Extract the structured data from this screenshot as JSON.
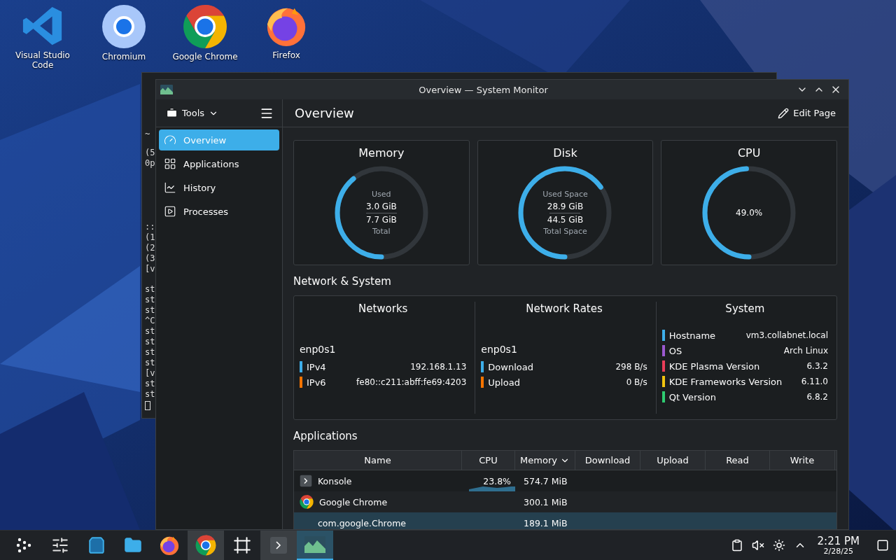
{
  "desktop_icons": [
    {
      "label": "Visual Studio Code",
      "kind": "vscode"
    },
    {
      "label": "Chromium",
      "kind": "chromium"
    },
    {
      "label": "Google Chrome",
      "kind": "chrome"
    },
    {
      "label": "Firefox",
      "kind": "firefox"
    }
  ],
  "terminal": {
    "line_groups": [
      [
        "~"
      ],
      [
        "(5",
        "0p"
      ],
      [
        "::",
        "(1",
        "(2",
        "(3",
        "[v"
      ],
      [
        "st",
        "st",
        "st",
        "^C",
        "st",
        "st",
        "st",
        "st",
        "[v",
        "st",
        "st"
      ]
    ]
  },
  "window": {
    "title": "Overview — System Monitor"
  },
  "toolbar": {
    "tools_label": "Tools",
    "page_title": "Overview",
    "edit_button": "Edit Page"
  },
  "sidebar": {
    "items": [
      {
        "label": "Overview",
        "kind": "gauge",
        "selected": true
      },
      {
        "label": "Applications",
        "kind": "grid",
        "selected": false
      },
      {
        "label": "History",
        "kind": "chart",
        "selected": false
      },
      {
        "label": "Processes",
        "kind": "play",
        "selected": false
      }
    ]
  },
  "summary_cards": [
    {
      "title": "Memory",
      "kind": "split",
      "level": 0.39,
      "top_label": "Used",
      "value_1": "3.0 GiB",
      "value_2": "7.7 GiB",
      "bottom_label": "Total"
    },
    {
      "title": "Disk",
      "kind": "split",
      "level": 0.65,
      "top_label": "Used Space",
      "value_1": "28.9 GiB",
      "value_2": "44.5 GiB",
      "bottom_label": "Total Space"
    },
    {
      "title": "CPU",
      "kind": "single",
      "level": 0.49,
      "value_1": "49.0%"
    }
  ],
  "network_section": {
    "heading": "Network & System",
    "columns": [
      {
        "title": "Networks",
        "kind": "network",
        "interface": "enp0s1",
        "rows": [
          {
            "label": "IPv4",
            "value": "192.168.1.13",
            "color": "#3daee9"
          },
          {
            "label": "IPv6",
            "value": "fe80::c211:abff:fe69:4203",
            "color": "#f67400"
          }
        ]
      },
      {
        "title": "Network Rates",
        "kind": "network",
        "interface": "enp0s1",
        "rows": [
          {
            "label": "Download",
            "value": "298 B/s",
            "color": "#3daee9"
          },
          {
            "label": "Upload",
            "value": "0 B/s",
            "color": "#f67400"
          }
        ]
      },
      {
        "title": "System",
        "kind": "system",
        "rows": [
          {
            "label": "Hostname",
            "value": "vm3.collabnet.local",
            "color": "#3daee9"
          },
          {
            "label": "OS",
            "value": "Arch Linux",
            "color": "#9b59d0"
          },
          {
            "label": "KDE Plasma Version",
            "value": "6.3.2",
            "color": "#e93d58"
          },
          {
            "label": "KDE Frameworks Version",
            "value": "6.11.0",
            "color": "#f1c40f"
          },
          {
            "label": "Qt Version",
            "value": "6.8.2",
            "color": "#2ecc71"
          }
        ]
      }
    ]
  },
  "applications": {
    "heading": "Applications",
    "columns": [
      {
        "label": "Name",
        "sorted": false
      },
      {
        "label": "CPU",
        "sorted": false
      },
      {
        "label": "Memory",
        "sorted": true
      },
      {
        "label": "Download",
        "sorted": false
      },
      {
        "label": "Upload",
        "sorted": false
      },
      {
        "label": "Read",
        "sorted": false
      },
      {
        "label": "Write",
        "sorted": false
      }
    ],
    "rows": [
      {
        "name": "Konsole",
        "kind": "konsole",
        "cpu": "23.8%",
        "memory": "574.7 MiB",
        "selected": false
      },
      {
        "name": "Google Chrome",
        "kind": "chrome",
        "memory": "300.1 MiB",
        "selected": false
      },
      {
        "name": "com.google.Chrome",
        "kind": "child",
        "memory": "189.1 MiB",
        "selected": true
      }
    ]
  },
  "taskbar": {
    "items": [
      {
        "kind": "launcher",
        "open": false,
        "selected": false
      },
      {
        "kind": "settings",
        "open": false,
        "selected": false
      },
      {
        "kind": "store",
        "open": false,
        "selected": false
      },
      {
        "kind": "files",
        "open": false,
        "selected": false
      },
      {
        "kind": "firefox",
        "open": false,
        "selected": false
      },
      {
        "kind": "chrome",
        "open": true,
        "selected": false
      },
      {
        "kind": "frame",
        "open": false,
        "selected": false
      },
      {
        "kind": "konsole",
        "open": true,
        "selected": false
      },
      {
        "kind": "monitor",
        "open": true,
        "selected": true
      }
    ],
    "tray": [
      {
        "kind": "clipboard"
      },
      {
        "kind": "muted"
      },
      {
        "kind": "brightness"
      },
      {
        "kind": "expand"
      }
    ],
    "clock": {
      "time": "2:21 PM",
      "date": "2/28/25"
    }
  }
}
